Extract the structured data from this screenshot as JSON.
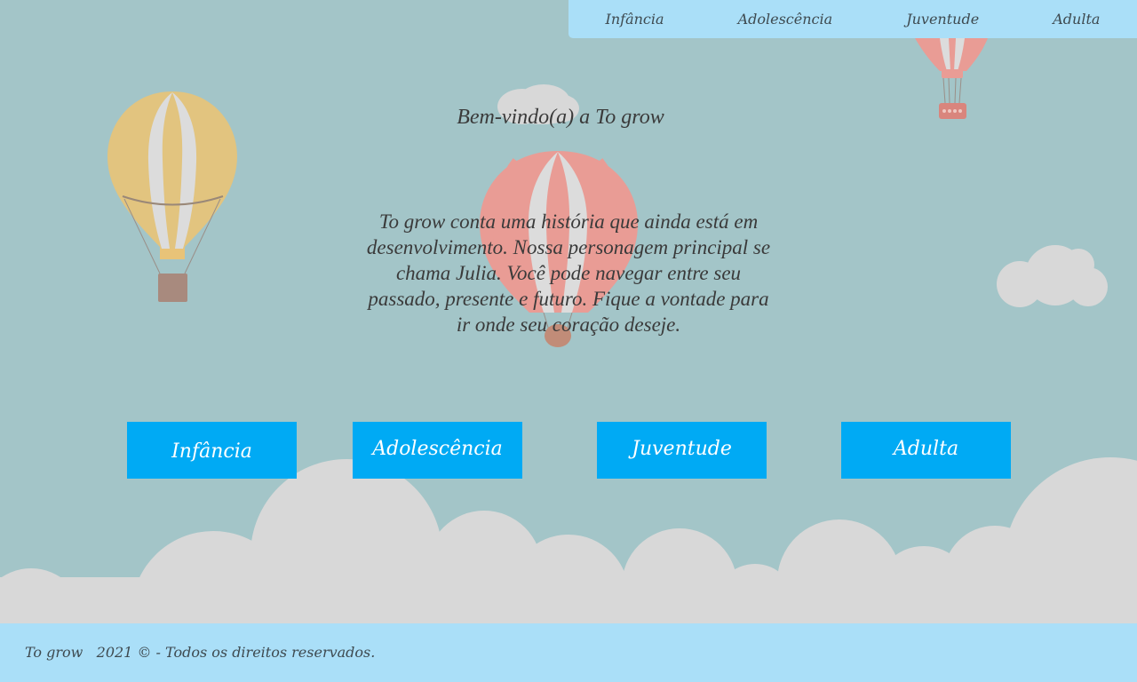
{
  "nav": {
    "items": [
      {
        "label": "Infância"
      },
      {
        "label": "Adolescência"
      },
      {
        "label": "Juventude"
      },
      {
        "label": "Adulta"
      }
    ]
  },
  "hero": {
    "welcome": "Bem-vindo(a) a To grow",
    "intro": "To grow conta uma história que ainda está em desenvolvimento. Nossa personagem principal se chama Julia. Você pode navegar entre seu passado, presente e futuro. Fique a vontade para ir onde seu coração deseje."
  },
  "buttons": [
    {
      "label": "Infância"
    },
    {
      "label": "Adolescência"
    },
    {
      "label": "Juventude"
    },
    {
      "label": "Adulta"
    }
  ],
  "footer": {
    "brand": "To grow",
    "copyright": "2021 © - Todos os direitos reservados."
  },
  "colors": {
    "sky": "#a3c5c8",
    "nav_background": "#aadff8",
    "button": "#00aaf4",
    "cloud": "#d8d8d8",
    "balloon_yellow": "#e2c47f",
    "balloon_red": "#e99c95"
  }
}
